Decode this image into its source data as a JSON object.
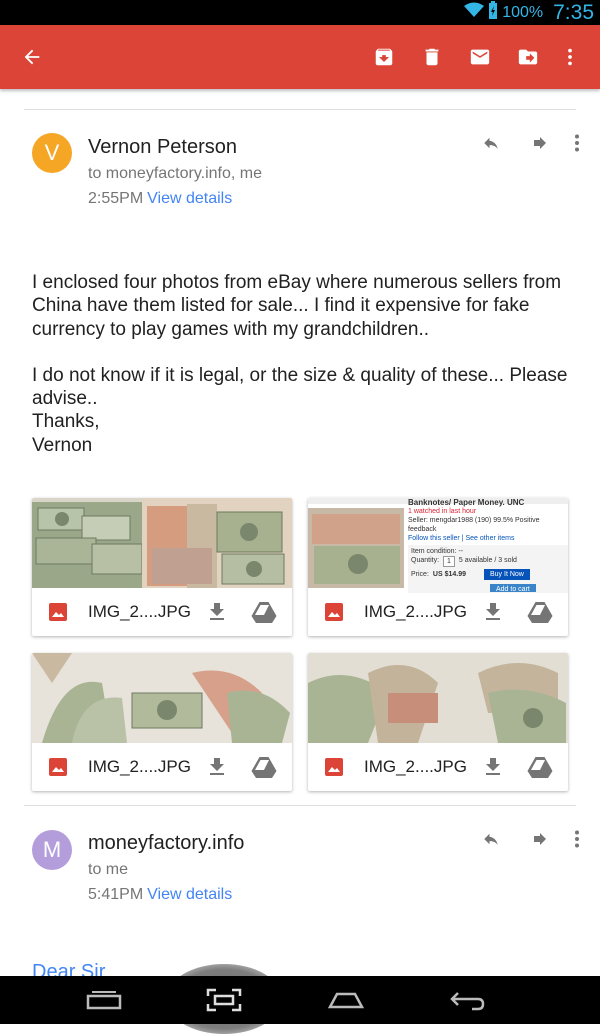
{
  "status_bar": {
    "battery_text": "100%",
    "clock": "7:35",
    "icons": [
      "wifi-icon",
      "battery-charging-icon"
    ]
  },
  "toolbar": {
    "back_icon": "back-arrow-icon",
    "actions": [
      "archive-icon",
      "delete-icon",
      "mark-unread-icon",
      "move-to-icon",
      "more-vert-icon"
    ]
  },
  "colors": {
    "toolbar": "#db4437",
    "link": "#4285f4",
    "avatar_v": "#f4a624",
    "avatar_m": "#b39ddb"
  },
  "message1": {
    "avatar_letter": "V",
    "sender": "Vernon Peterson",
    "recipients": "to moneyfactory.info, me",
    "time": "2:55PM",
    "details_link": "View details",
    "body": [
      "I enclosed four photos from eBay where numerous sellers from China have them listed for sale... I find it expensive for fake currency to play games with my grandchildren..",
      "I do not know if it is legal, or the size & quality of these... Please advise..",
      "Thanks,",
      "Vernon"
    ],
    "attachments": [
      {
        "name": "IMG_2....JPG"
      },
      {
        "name": "IMG_2....JPG"
      },
      {
        "name": "IMG_2....JPG"
      },
      {
        "name": "IMG_2....JPG"
      }
    ],
    "screenshot_thumb": {
      "title_line1": "Banknotes/ Paper Money. UNC",
      "watched": "1 watched in last hour",
      "seller": "Seller: mengdar1988 (190) 99.5% Positive feedback",
      "follow": "Follow this seller | See other items",
      "condition": "Item condition: --",
      "quantity": "Quantity:",
      "quantity_val": "1",
      "available": "5 available / 3 sold",
      "price_label": "Price:",
      "price": "US $14.99",
      "buy_now": "Buy It Now",
      "add_to_cart": "Add to cart"
    }
  },
  "message2": {
    "avatar_letter": "M",
    "sender": "moneyfactory.info",
    "recipients": "to me",
    "time": "5:41PM",
    "details_link": "View details",
    "body_peek": "Dear Sir"
  },
  "nav_bar": [
    "recents-icon",
    "screenshot-icon",
    "home-icon",
    "back-nav-icon"
  ]
}
